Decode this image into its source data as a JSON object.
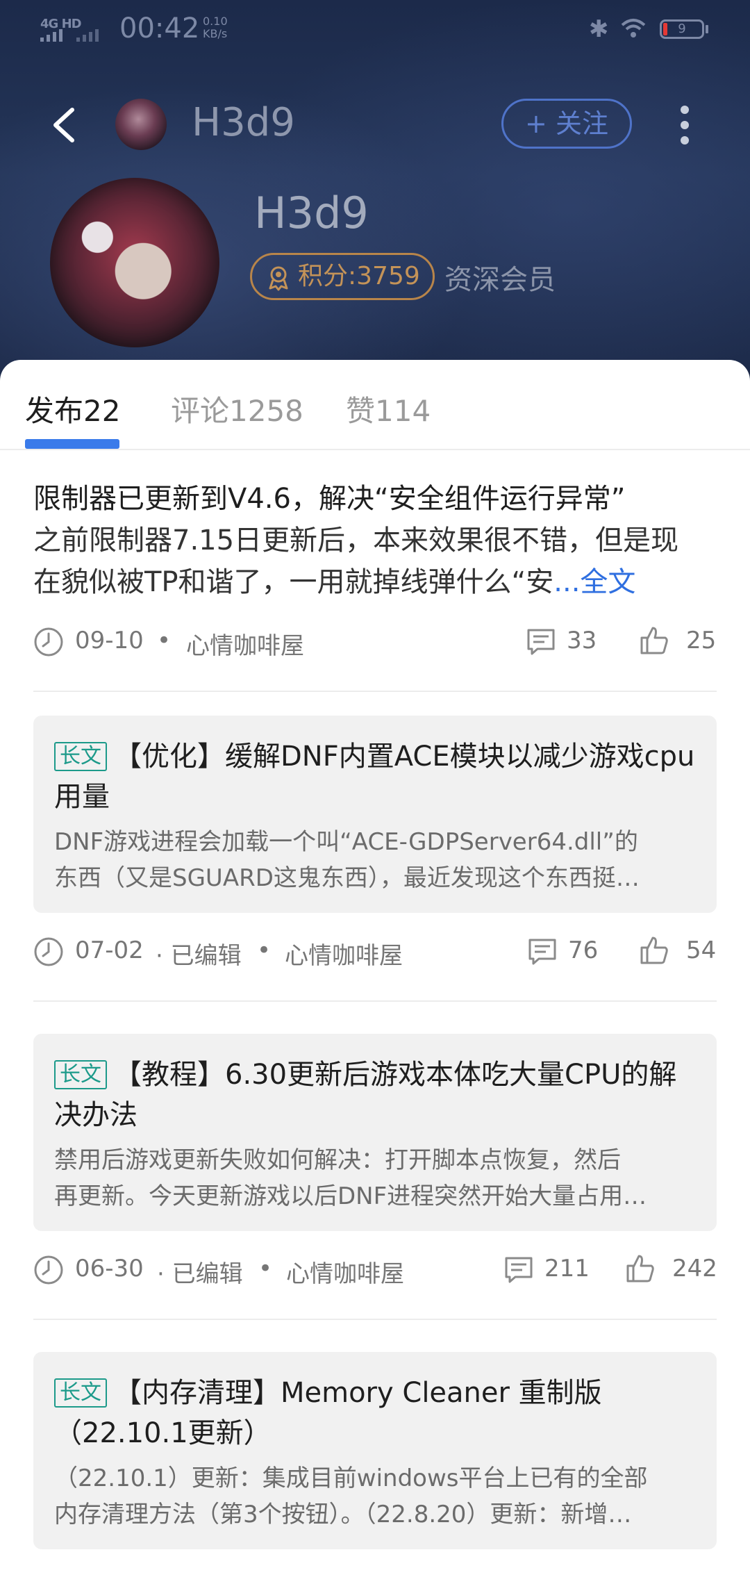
{
  "status_bar": {
    "network": "4G HD",
    "time": "00:42",
    "speed_value": "0.10",
    "speed_unit": "KB/s",
    "battery": "9"
  },
  "header": {
    "title": "H3d9",
    "follow_label": "+ 关注",
    "profile_name": "H3d9",
    "points_label": "积分:3759",
    "member_level": "资深会员"
  },
  "tabs": [
    {
      "label": "发布22",
      "active": true
    },
    {
      "label": "评论1258",
      "active": false
    },
    {
      "label": "赞114",
      "active": false
    }
  ],
  "posts": [
    {
      "title": "限制器已更新到V4.6，解决“安全组件运行异常”",
      "body_line1": "之前限制器7.15日更新后，本来效果很不错，但是现",
      "body_line2": "在貌似被TP和谐了，一用就掉线弹什么“安",
      "more_label": "...全文",
      "date": "09-10",
      "board": "心情咖啡屋",
      "comments": "33",
      "likes": "25"
    },
    {
      "tag": "长文",
      "title": "【优化】缓解DNF内置ACE模块以减少游戏cpu用量",
      "excerpt_line1": " DNF游戏进程会加载一个叫“ACE-GDPServer64.dll”的",
      "excerpt_line2": "东西（又是SGUARD这鬼东西），最近发现这个东西挺…",
      "date": "07-02",
      "edited": "· 已编辑",
      "board": "心情咖啡屋",
      "comments": "76",
      "likes": "54"
    },
    {
      "tag": "长文",
      "title": "【教程】6.30更新后游戏本体吃大量CPU的解决办法",
      "excerpt_line1": " 禁用后游戏更新失败如何解决：打开脚本点恢复，然后",
      "excerpt_line2": "再更新。今天更新游戏以后DNF进程突然开始大量占用…",
      "date": "06-30",
      "edited": "· 已编辑",
      "board": "心情咖啡屋",
      "comments": "211",
      "likes": "242"
    },
    {
      "tag": "长文",
      "title": "【内存清理】Memory Cleaner 重制版（22.10.1更新）",
      "excerpt_line1": "（22.10.1）更新：集成目前windows平台上已有的全部",
      "excerpt_line2": "内存清理方法（第3个按钮）。（22.8.20）更新：新增…"
    }
  ],
  "colors": {
    "accent": "#3a7bea",
    "tag": "#1c9a8a",
    "points": "#c49358",
    "follow": "#5e7fcf"
  }
}
